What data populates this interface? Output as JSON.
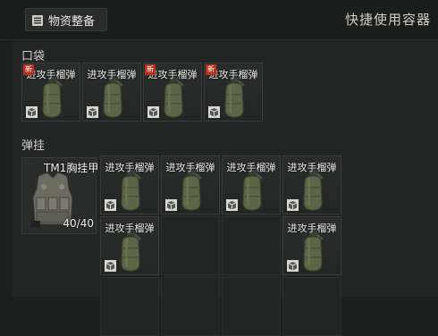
{
  "header": {
    "tab_label": "物资整备",
    "quick_container_title": "快捷使用容器"
  },
  "pocket": {
    "label": "口袋",
    "items": [
      {
        "name": "进攻手榴弹",
        "new": true
      },
      {
        "name": "进攻手榴弹",
        "new": false
      },
      {
        "name": "进攻手榴弹",
        "new": true
      },
      {
        "name": "进攻手榴弹",
        "new": true
      }
    ],
    "new_badge": "新"
  },
  "rig": {
    "label": "弹挂",
    "vest_name": "TM1胸挂甲",
    "vest_capacity": "40/40",
    "items": [
      {
        "name": "进攻手榴弹"
      },
      {
        "name": "进攻手榴弹"
      },
      {
        "name": "进攻手榴弹"
      },
      {
        "name": "进攻手榴弹"
      },
      {
        "name": "进攻手榴弹"
      },
      {
        "name": "进攻手榴弹"
      }
    ]
  },
  "colors": {
    "grenade": "#5a6645",
    "new_badge": "#b5321f"
  }
}
